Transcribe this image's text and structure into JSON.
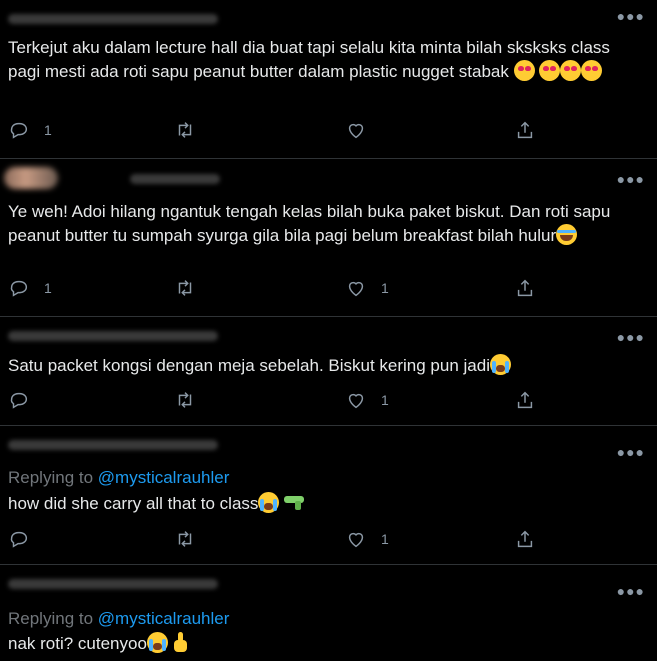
{
  "tweets": [
    {
      "text": "Terkejut aku dalam lecture hall dia buat tapi selalu kita minta bilah sksksks class pagi mesti ada roti sapu peanut butter dalam plastic nugget stabak",
      "reply_count": "1",
      "retweet_count": "",
      "like_count": ""
    },
    {
      "text": "Ye weh! Adoi hilang ngantuk tengah kelas bilah buka paket biskut. Dan roti sapu peanut butter tu sumpah syurga gila bila pagi belum breakfast bilah hulur",
      "reply_count": "1",
      "retweet_count": "",
      "like_count": "1"
    },
    {
      "text": "Satu packet kongsi dengan meja sebelah. Biskut kering pun jadi",
      "reply_count": "",
      "retweet_count": "",
      "like_count": "1"
    },
    {
      "replying_to_label": "Replying to",
      "replying_to_handle": "@mysticalrauhler",
      "text": "how did she carry all that to class",
      "reply_count": "",
      "retweet_count": "",
      "like_count": "1"
    },
    {
      "replying_to_label": "Replying to",
      "replying_to_handle": "@mysticalrauhler",
      "text": "nak roti? cutenyoo"
    }
  ],
  "icons": {
    "more": "more-icon",
    "reply": "reply-icon",
    "retweet": "retweet-icon",
    "like": "like-icon",
    "share": "share-icon"
  },
  "colors": {
    "background": "#000000",
    "text": "#e7e9ea",
    "muted": "#8b98a5",
    "mention": "#1d9bf0",
    "divider": "#2f3336"
  }
}
